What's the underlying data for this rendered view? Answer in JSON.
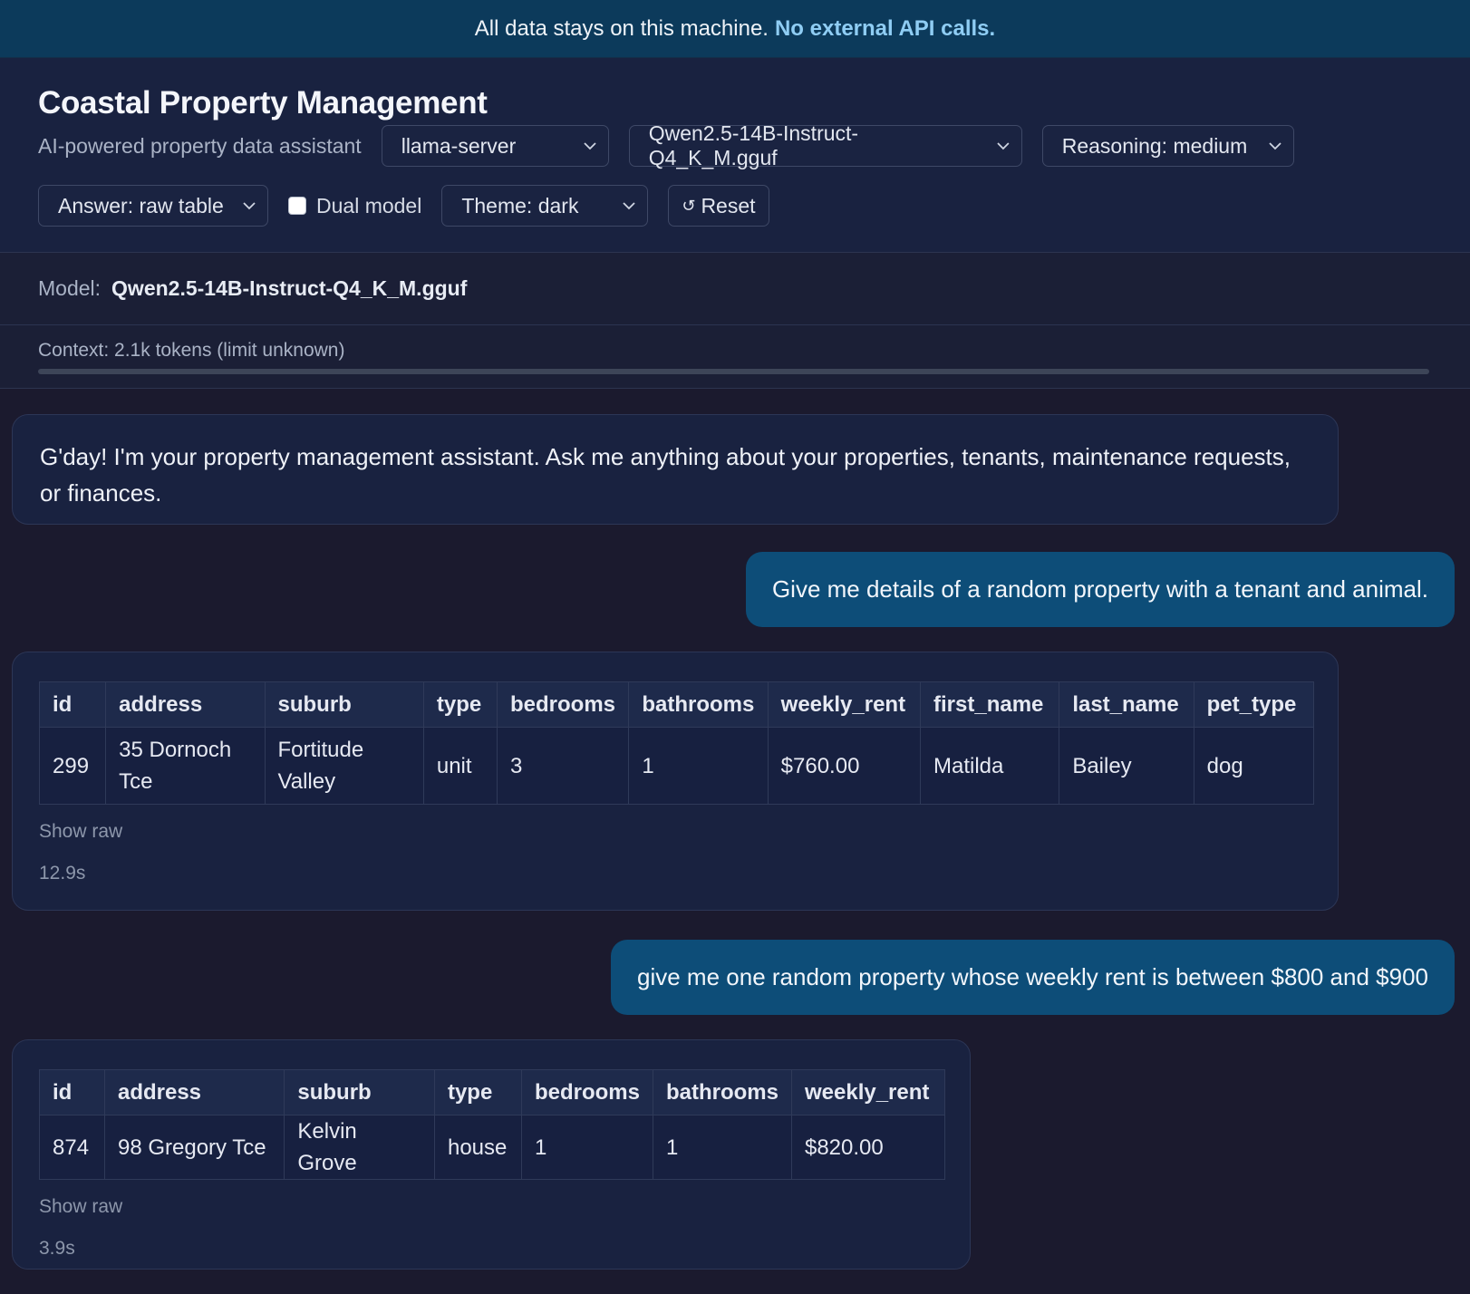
{
  "banner": {
    "text": "All data stays on this machine.",
    "highlight": "No external API calls."
  },
  "header": {
    "title": "Coastal Property Management",
    "subtitle": "AI-powered property data assistant",
    "backend_select": "llama-server",
    "model_select": "Qwen2.5-14B-Instruct-Q4_K_M.gguf",
    "reasoning_select": "Reasoning: medium",
    "answer_select": "Answer: raw table",
    "dual_model_label": "Dual model",
    "dual_model_checked": false,
    "theme_select": "Theme: dark",
    "reset_label": "Reset",
    "reset_icon": "↺"
  },
  "model_info": {
    "label": "Model:",
    "value": "Qwen2.5-14B-Instruct-Q4_K_M.gguf"
  },
  "context": {
    "text": "Context: 2.1k tokens (limit unknown)",
    "fill_fraction": 0.0
  },
  "messages": {
    "greeting": "G'day! I'm your property management assistant. Ask me anything about your properties, tenants, maintenance requests, or finances.",
    "user1": "Give me details of a random property with a tenant and animal.",
    "result1": {
      "headers": [
        "id",
        "address",
        "suburb",
        "type",
        "bedrooms",
        "bathrooms",
        "weekly_rent",
        "first_name",
        "last_name",
        "pet_type"
      ],
      "row": [
        "299",
        "35 Dornoch Tce",
        "Fortitude Valley",
        "unit",
        "3",
        "1",
        "$760.00",
        "Matilda",
        "Bailey",
        "dog"
      ],
      "show_raw": "Show raw",
      "time": "12.9s"
    },
    "user2": "give me one random property whose weekly rent is between $800 and $900",
    "result2": {
      "headers": [
        "id",
        "address",
        "suburb",
        "type",
        "bedrooms",
        "bathrooms",
        "weekly_rent"
      ],
      "row": [
        "874",
        "98 Gregory Tce",
        "Kelvin Grove",
        "house",
        "1",
        "1",
        "$820.00"
      ],
      "show_raw": "Show raw",
      "time": "3.9s"
    }
  }
}
